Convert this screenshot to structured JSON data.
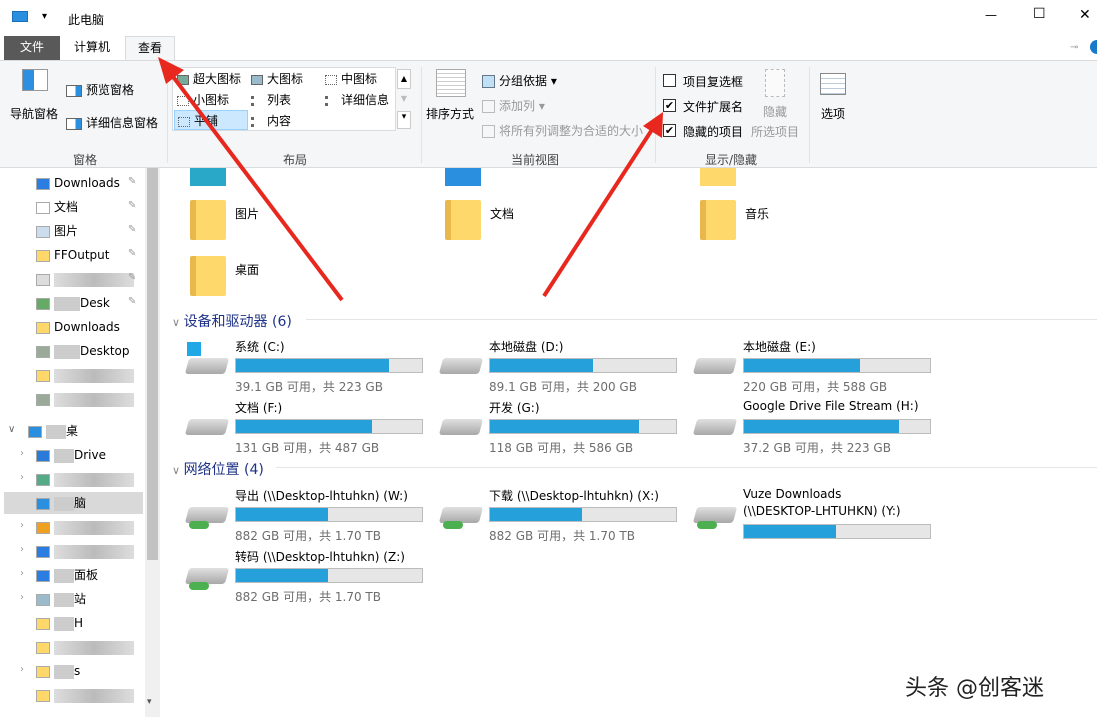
{
  "window": {
    "title": "此电脑",
    "minimize": "—",
    "maximize": "☐",
    "close": "✕"
  },
  "tabs": [
    {
      "label": "文件"
    },
    {
      "label": "计算机"
    },
    {
      "label": "查看"
    }
  ],
  "ribbon": {
    "panes": {
      "nav_pane": "导航窗格",
      "preview": "预览窗格",
      "details": "详细信息窗格",
      "group": "窗格"
    },
    "layout": {
      "items": [
        "超大图标",
        "大图标",
        "中图标",
        "小图标",
        "列表",
        "详细信息",
        "平铺",
        "内容"
      ],
      "selected": "平铺",
      "group": "布局"
    },
    "current_view": {
      "sort": "排序方式",
      "group_by": "分组依据",
      "add_col": "添加列",
      "fit_cols": "将所有列调整为合适的大小",
      "group": "当前视图"
    },
    "show_hide": {
      "item_checkboxes": "项目复选框",
      "item_checkboxes_checked": false,
      "file_ext": "文件扩展名",
      "file_ext_checked": true,
      "hidden_items": "隐藏的项目",
      "hidden_items_checked": true,
      "hide_selected_1": "隐藏",
      "hide_selected_2": "所选项目",
      "group": "显示/隐藏"
    },
    "options": "选项"
  },
  "nav": {
    "items": [
      {
        "label": "Downloads",
        "pinned": true
      },
      {
        "label": "文档",
        "pinned": true
      },
      {
        "label": "图片",
        "pinned": true
      },
      {
        "label": "FFOutput",
        "pinned": true
      },
      {
        "label": "",
        "pinned": true
      },
      {
        "label": "Desk",
        "pinned": true
      },
      {
        "label": "Downloads"
      },
      {
        "label": "Desktop"
      },
      {
        "label": ""
      },
      {
        "label": ""
      },
      {
        "label": "桌"
      },
      {
        "label": "Drive"
      },
      {
        "label": ""
      },
      {
        "label": "脑"
      },
      {
        "label": ""
      },
      {
        "label": ""
      },
      {
        "label": "面板"
      },
      {
        "label": "站"
      },
      {
        "label": "H"
      },
      {
        "label": ""
      },
      {
        "label": "s"
      },
      {
        "label": ""
      }
    ]
  },
  "folders": [
    {
      "name": "图片"
    },
    {
      "name": "文档"
    },
    {
      "name": "音乐"
    },
    {
      "name": "桌面"
    }
  ],
  "devices": {
    "header": "设备和驱动器 (6)",
    "items": [
      {
        "name": "系统 (C:)",
        "free": "39.1 GB 可用，共 223 GB",
        "used_pct": 82.5
      },
      {
        "name": "本地磁盘 (D:)",
        "free": "89.1 GB 可用，共 200 GB",
        "used_pct": 55.5
      },
      {
        "name": "本地磁盘 (E:)",
        "free": "220 GB 可用，共 588 GB",
        "used_pct": 62.6
      },
      {
        "name": "文档 (F:)",
        "free": "131 GB 可用，共 487 GB",
        "used_pct": 73.1
      },
      {
        "name": "开发 (G:)",
        "free": "118 GB 可用，共 586 GB",
        "used_pct": 79.9
      },
      {
        "name": "Google Drive File Stream (H:)",
        "free": "37.2 GB 可用，共 223 GB",
        "used_pct": 83.3
      }
    ]
  },
  "network": {
    "header": "网络位置 (4)",
    "items": [
      {
        "name": "导出 (\\\\Desktop-lhtuhkn) (W:)",
        "free": "882 GB 可用，共 1.70 TB",
        "used_pct": 49.3
      },
      {
        "name": "下载 (\\\\Desktop-lhtuhkn) (X:)",
        "free": "882 GB 可用，共 1.70 TB",
        "used_pct": 49.3
      },
      {
        "name": "Vuze Downloads",
        "name2": "(\\\\DESKTOP-LHTUHKN) (Y:)",
        "free": "",
        "used_pct": 49.3
      },
      {
        "name": "转码 (\\\\Desktop-lhtuhkn) (Z:)",
        "free": "882 GB 可用，共 1.70 TB",
        "used_pct": 49.3
      }
    ]
  },
  "watermark": "头条 @创客迷",
  "colors": {
    "accent": "#26a0da",
    "file_tab": "#595959",
    "annotation_arrow": "#e8281e"
  }
}
